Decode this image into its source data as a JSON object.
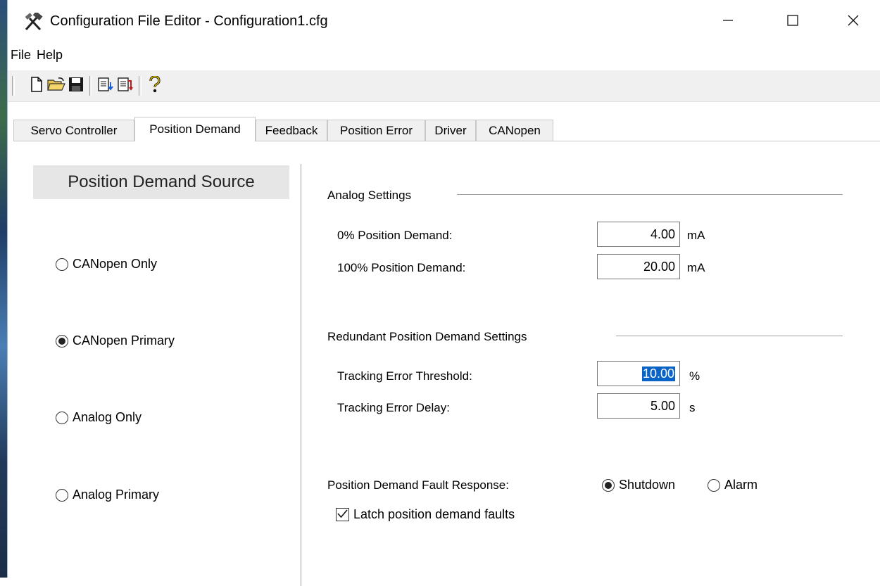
{
  "window": {
    "title": "Configuration File Editor - Configuration1.cfg",
    "controls": {
      "minimize_icon": "minimize-icon",
      "maximize_icon": "maximize-icon",
      "close_icon": "close-icon"
    }
  },
  "menu": {
    "items": [
      "File",
      "Help"
    ]
  },
  "toolbar": {
    "buttons": [
      "new-file-icon",
      "open-folder-icon",
      "save-icon",
      "import-icon",
      "export-icon",
      "help-icon"
    ]
  },
  "tabs": [
    {
      "label": "Servo Controller",
      "active": false
    },
    {
      "label": "Position Demand",
      "active": true
    },
    {
      "label": "Feedback",
      "active": false
    },
    {
      "label": "Position Error",
      "active": false
    },
    {
      "label": "Driver",
      "active": false
    },
    {
      "label": "CANopen",
      "active": false
    }
  ],
  "source": {
    "header": "Position Demand Source",
    "options": [
      {
        "label": "CANopen Only",
        "selected": false
      },
      {
        "label": "CANopen Primary",
        "selected": true
      },
      {
        "label": "Analog Only",
        "selected": false
      },
      {
        "label": "Analog Primary",
        "selected": false
      }
    ]
  },
  "analog": {
    "title": "Analog Settings",
    "zero_label": "0% Position Demand:",
    "zero_value": "4.00",
    "zero_unit": "mA",
    "full_label": "100% Position Demand:",
    "full_value": "20.00",
    "full_unit": "mA"
  },
  "redundant": {
    "title": "Redundant Position Demand Settings",
    "threshold_label": "Tracking Error Threshold:",
    "threshold_value": "10.00",
    "threshold_unit": "%",
    "delay_label": "Tracking Error Delay:",
    "delay_value": "5.00",
    "delay_unit": "s"
  },
  "fault": {
    "label": "Position Demand Fault Response:",
    "options": [
      {
        "label": "Shutdown",
        "selected": true
      },
      {
        "label": "Alarm",
        "selected": false
      }
    ],
    "latch_label": "Latch position demand faults",
    "latch_checked": true
  }
}
